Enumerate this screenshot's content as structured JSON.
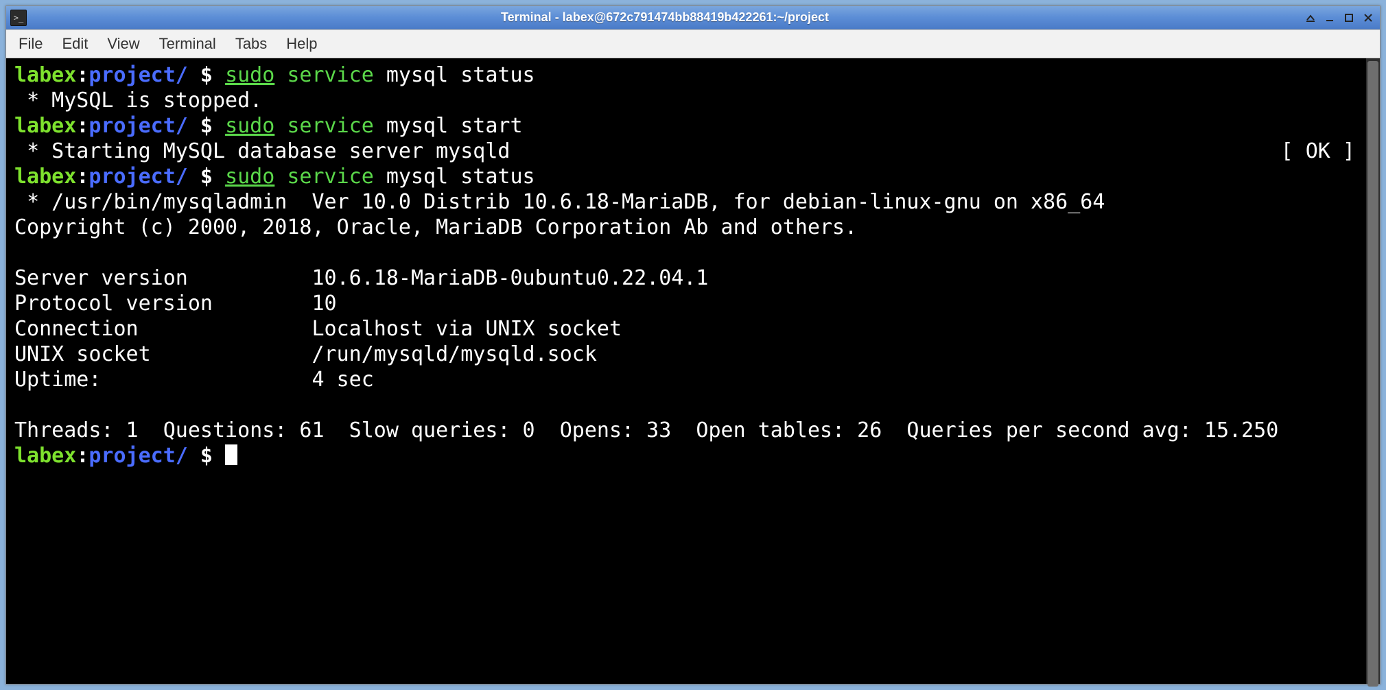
{
  "window": {
    "title": "Terminal - labex@672c791474bb88419b422261:~/project"
  },
  "menubar": {
    "items": [
      "File",
      "Edit",
      "View",
      "Terminal",
      "Tabs",
      "Help"
    ]
  },
  "prompt": {
    "user": "labex",
    "sep": ":",
    "path": "project/",
    "sigil": " $ "
  },
  "cmd": {
    "sudo": "sudo",
    "service": "service",
    "args_status": " mysql status",
    "args_start": " mysql start"
  },
  "out": {
    "stopped": " * MySQL is stopped.",
    "starting_msg": " * Starting MySQL database server mysqld",
    "ok": "[ OK ]",
    "admin_line": " * /usr/bin/mysqladmin  Ver 10.0 Distrib 10.6.18-MariaDB, for debian-linux-gnu on x86_64",
    "copyright": "Copyright (c) 2000, 2018, Oracle, MariaDB Corporation Ab and others.",
    "blank": "",
    "server_version": "Server version          10.6.18-MariaDB-0ubuntu0.22.04.1",
    "protocol_version": "Protocol version        10",
    "connection": "Connection              Localhost via UNIX socket",
    "unix_socket": "UNIX socket             /run/mysqld/mysqld.sock",
    "uptime": "Uptime:                 4 sec",
    "stats": "Threads: 1  Questions: 61  Slow queries: 0  Opens: 33  Open tables: 26  Queries per second avg: 15.250"
  }
}
